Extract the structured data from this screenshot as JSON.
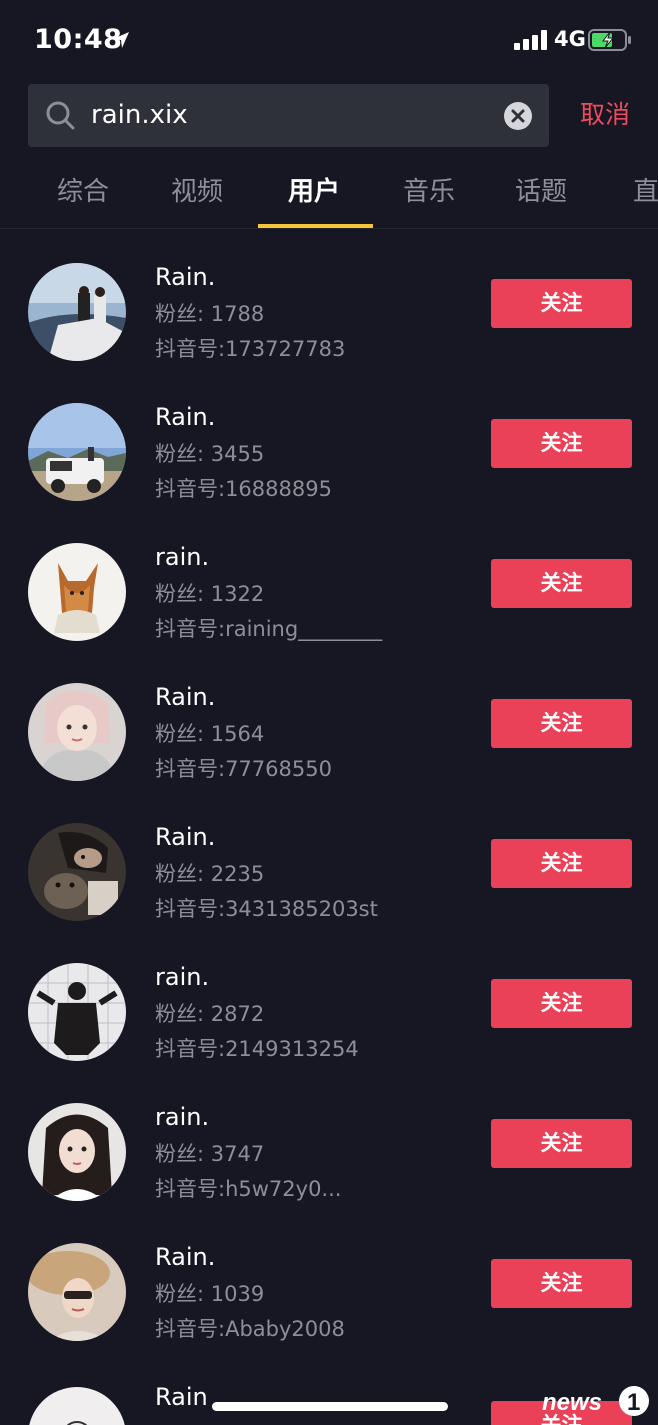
{
  "status_bar": {
    "time": "10:48",
    "network": "4G",
    "icons": [
      "location-arrow-icon",
      "cellular-signal-icon",
      "battery-charging-icon"
    ]
  },
  "search": {
    "query": "rain.xix",
    "cancel_label": "取消",
    "icons": [
      "search-icon",
      "clear-icon"
    ]
  },
  "tabs": [
    {
      "label": "综合",
      "active": false
    },
    {
      "label": "视频",
      "active": false
    },
    {
      "label": "用户",
      "active": true
    },
    {
      "label": "音乐",
      "active": false
    },
    {
      "label": "话题",
      "active": false
    },
    {
      "label": "直",
      "active": false
    }
  ],
  "colors": {
    "background": "#161722",
    "accent_red": "#ea4159",
    "tab_indicator": "#f4c43b",
    "secondary_text": "#8e8f96"
  },
  "follow_label": "关注",
  "users": [
    {
      "name": "Rain.",
      "fans": "粉丝: 1788",
      "douyin_id": "抖音号:173727783"
    },
    {
      "name": "Rain.",
      "fans": "粉丝: 3455",
      "douyin_id": "抖音号:16888895"
    },
    {
      "name": "rain.",
      "fans": "粉丝: 1322",
      "douyin_id": "抖音号:raining________"
    },
    {
      "name": "Rain.",
      "fans": "粉丝: 1564",
      "douyin_id": "抖音号:77768550"
    },
    {
      "name": "Rain.",
      "fans": "粉丝: 2235",
      "douyin_id": "抖音号:3431385203st"
    },
    {
      "name": "rain.",
      "fans": "粉丝: 2872",
      "douyin_id": "抖音号:2149313254"
    },
    {
      "name": "rain.",
      "fans": "粉丝: 3747",
      "douyin_id": "抖音号:h5w72y0..."
    },
    {
      "name": "Rain.",
      "fans": "粉丝: 1039",
      "douyin_id": "抖音号:Ababy2008"
    },
    {
      "name": "Rain",
      "fans": "",
      "douyin_id": ""
    }
  ],
  "watermark": "news1"
}
